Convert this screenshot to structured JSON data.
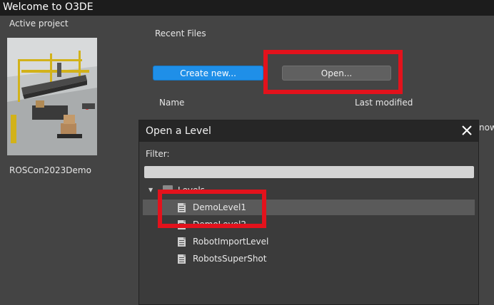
{
  "window": {
    "title": "Welcome to O3DE"
  },
  "left_panel": {
    "active_project_label": "Active project",
    "project_name": "ROSCon2023Demo"
  },
  "recent_files": {
    "label": "Recent Files",
    "create_button": "Create new...",
    "open_button": "Open...",
    "columns": {
      "name": "Name",
      "last_modified": "Last modified"
    },
    "overflow_text": "now"
  },
  "dialog": {
    "title": "Open a Level",
    "filter_label": "Filter:",
    "filter_value": "",
    "tree": {
      "folder": "Levels",
      "items": [
        {
          "label": "DemoLevel1",
          "selected": true
        },
        {
          "label": "DemoLevel2",
          "selected": false
        },
        {
          "label": "RobotImportLevel",
          "selected": false
        },
        {
          "label": "RobotsSuperShot",
          "selected": false
        }
      ]
    }
  },
  "colors": {
    "primary_button": "#1f8fe8",
    "highlight": "#e3121c",
    "selection": "#5a5a5a"
  },
  "icons": [
    "close-icon",
    "expand-caret-icon",
    "folder-icon",
    "level-file-icon"
  ]
}
